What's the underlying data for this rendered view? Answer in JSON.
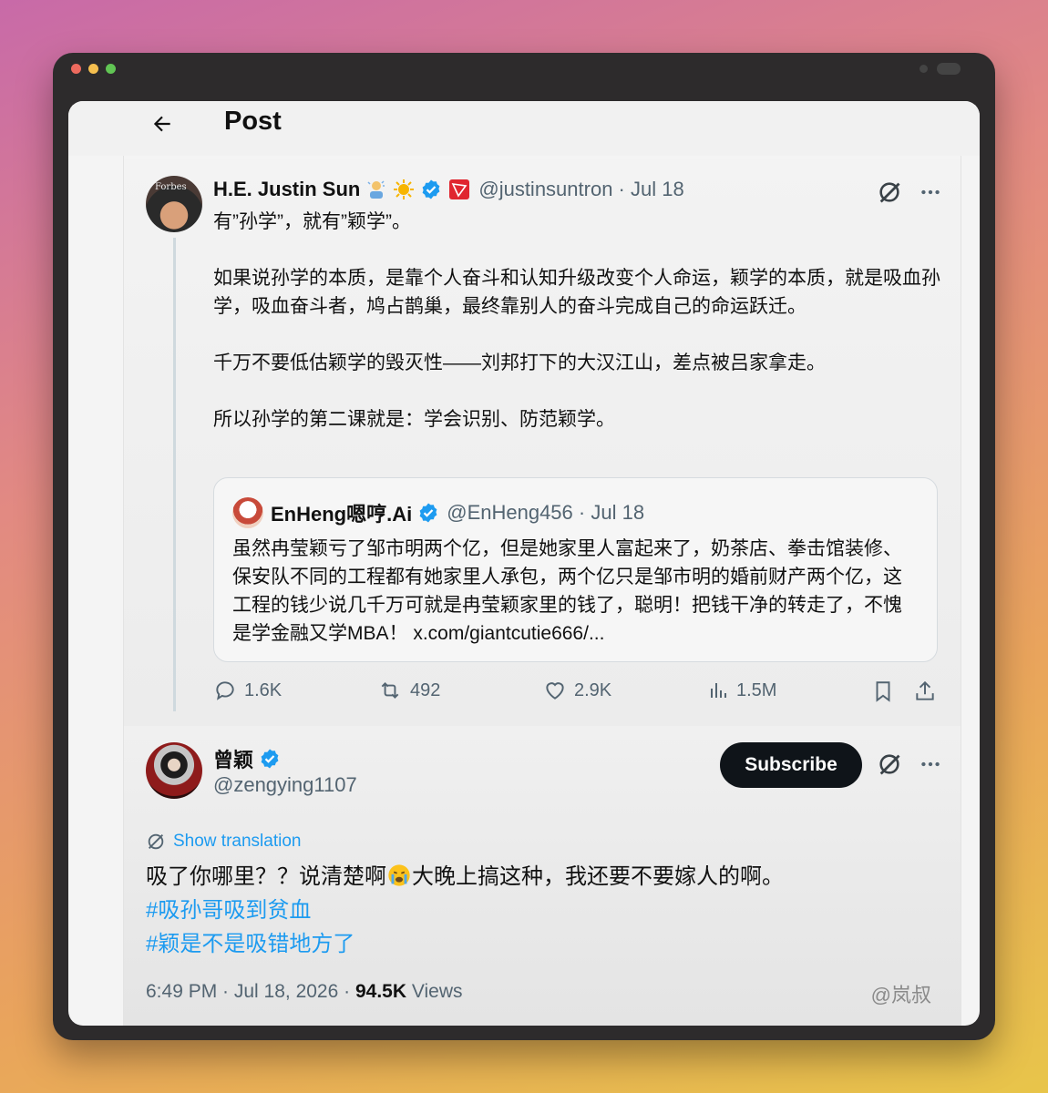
{
  "header": {
    "title": "Post"
  },
  "tweet": {
    "author_name": "H.E. Justin Sun",
    "handle": "@justinsuntron",
    "date": "Jul 18",
    "avatar_text": "Forbes",
    "paragraphs": [
      "有”孙学”，就有”颖学”。",
      "如果说孙学的本质，是靠个人奋斗和认知升级改变个人命运，颖学的本质，就是吸血孙学，吸血奋斗者，鸠占鹊巢，最终靠别人的奋斗完成自己的命运跃迁。",
      "千万不要低估颖学的毁灭性——刘邦打下的大汉江山，差点被吕家拿走。",
      "所以孙学的第二课就是：学会识别、防范颖学。"
    ],
    "quote": {
      "author_name": "EnHeng嗯哼.Ai",
      "handle": "@EnHeng456",
      "date": "Jul 18",
      "text": "虽然冉莹颖亏了邹市明两个亿，但是她家里人富起来了，奶茶店、拳击馆装修、保安队不同的工程都有她家里人承包，两个亿只是邹市明的婚前财产两个亿，这工程的钱少说几千万可就是冉莹颖家里的钱了，聪明！把钱干净的转走了，不愧是学金融又学MBA！ x.com/giantcutie666/..."
    },
    "stats": {
      "replies": "1.6K",
      "reposts": "492",
      "likes": "2.9K",
      "views": "1.5M"
    }
  },
  "reply": {
    "author_name": "曾颖",
    "handle": "@zengying1107",
    "subscribe_label": "Subscribe",
    "translate_label": "Show translation",
    "text_before": "吸了你哪里？？说清楚啊",
    "text_after": "大晚上搞这种，我还要不要嫁人的啊。",
    "hashtags": [
      "#吸孙哥吸到贫血",
      "#颖是不是吸错地方了"
    ],
    "time": "6:49 PM · Jul 18, 2026 · ",
    "views_count": "94.5K",
    "views_label": " Views"
  },
  "watermark": "@岚叔",
  "colors": {
    "accent": "#1d9bf0",
    "verified": "#1d9bf0",
    "tron": "#e0262f"
  },
  "icons": [
    "back-arrow-icon",
    "grok-icon",
    "more-icon",
    "reply-icon",
    "repost-icon",
    "like-icon",
    "views-icon",
    "bookmark-icon",
    "share-icon",
    "translate-icon",
    "verified-icon"
  ]
}
